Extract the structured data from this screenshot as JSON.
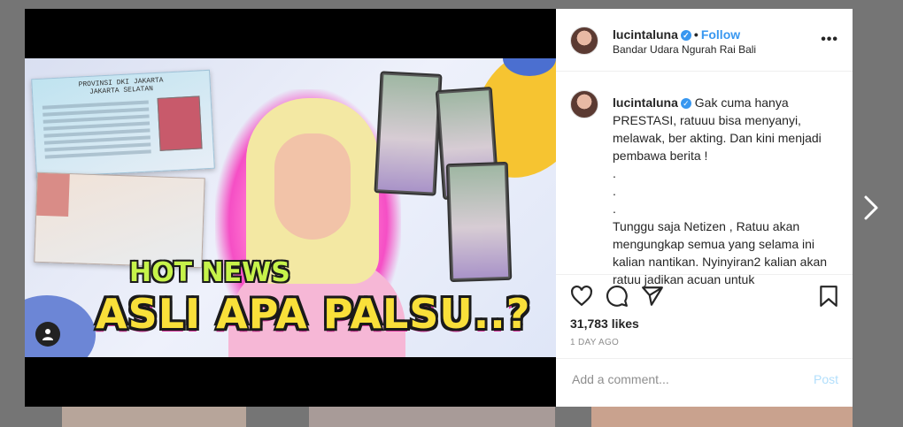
{
  "header": {
    "username": "lucintaluna",
    "verified_mark": "✓",
    "dot": "•",
    "follow_label": "Follow",
    "location": "Bandar Udara Ngurah Rai Bali",
    "more_label": "•••"
  },
  "media": {
    "hot_news": "HOT NEWS",
    "headline": "ASLI APA PALSU..?",
    "idcard_title": "PROVINSI DKI JAKARTA\nJAKARTA SELATAN"
  },
  "caption": {
    "username": "lucintaluna",
    "text": " Gak cuma hanya PRESTASI, ratuuu bisa menyanyi, melawak, ber akting. Dan kini menjadi pembawa berita !\n.\n.\n.\nTunggu saja Netizen , Ratuu akan mengungkap semua yang selama ini kalian nantikan. Nyinyiran2 kalian akan ratuu jadikan acuan untuk"
  },
  "stats": {
    "likes": "31,783 likes",
    "time": "1 DAY AGO"
  },
  "comment": {
    "placeholder": "Add a comment...",
    "post_label": "Post"
  },
  "icons": {
    "like": "heart-icon",
    "comment": "comment-icon",
    "share": "paper-plane-icon",
    "save": "bookmark-icon",
    "tag": "user-tag-icon",
    "next": "chevron-right-icon"
  },
  "colors": {
    "accent": "#3897f0",
    "post_disabled": "#b2dffc",
    "overlay": "#757575"
  }
}
